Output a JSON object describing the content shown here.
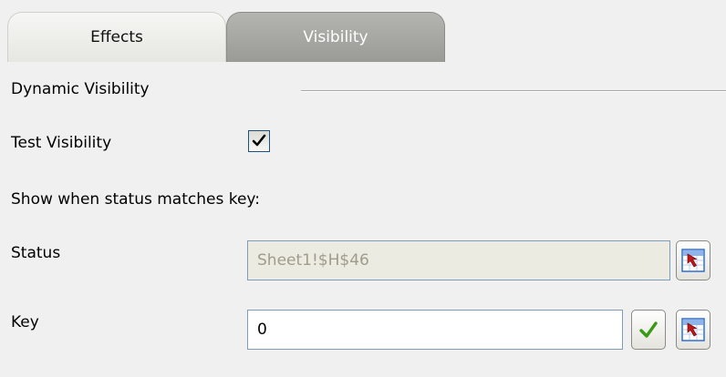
{
  "tabs": [
    {
      "label": "Effects",
      "active": false
    },
    {
      "label": "Visibility",
      "active": true
    }
  ],
  "section": {
    "dynamic_visibility_label": "Dynamic Visibility"
  },
  "test_visibility": {
    "label": "Test Visibility",
    "checked": true
  },
  "instruction": "Show when status matches key:",
  "status": {
    "label": "Status",
    "value": "Sheet1!$H$46",
    "disabled": true,
    "picker_icon": "cell-reference-picker-icon"
  },
  "key": {
    "label": "Key",
    "value": "0",
    "confirm_icon": "green-check-icon",
    "picker_icon": "cell-reference-picker-icon"
  },
  "colors": {
    "background": "#f0f0f0",
    "active_tab": "#a6a6a2",
    "inactive_tab": "#ececea",
    "checkmark": "#3a9a16",
    "picker_arrow": "#c01818",
    "picker_bg": "#2f6fd6"
  }
}
